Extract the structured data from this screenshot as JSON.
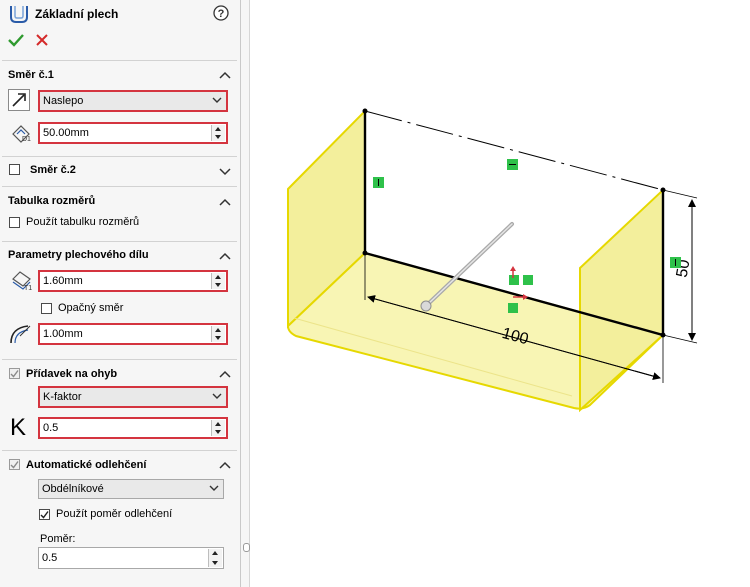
{
  "header": {
    "title": "Základní plech",
    "help_icon": "help-icon"
  },
  "actions": {
    "ok_icon": "check-icon",
    "cancel_icon": "close-icon"
  },
  "direction1": {
    "title": "Směr č.1",
    "end_condition": "Naslepo",
    "depth": "50.00mm"
  },
  "direction2": {
    "title": "Směr č.2"
  },
  "gauge_table": {
    "title": "Tabulka rozměrů",
    "use_table_label": "Použít tabulku rozměrů"
  },
  "sheet_params": {
    "title": "Parametry plechového dílu",
    "thickness": "1.60mm",
    "reverse_label": "Opačný směr",
    "bend_radius": "1.00mm"
  },
  "bend_allowance": {
    "title": "Přídavek na ohyb",
    "type": "K-faktor",
    "k_symbol": "K",
    "k_value": "0.5"
  },
  "auto_relief": {
    "title": "Automatické odlehčení",
    "type": "Obdélníkové",
    "use_ratio_label": "Použít poměr odlehčení",
    "ratio_label": "Poměr:",
    "ratio_value": "0.5"
  },
  "viewport": {
    "dim_width": "100",
    "dim_height": "50",
    "part_color": "#f5f08a",
    "edge_color": "#e6d800",
    "accent_color": "#d4343f"
  }
}
